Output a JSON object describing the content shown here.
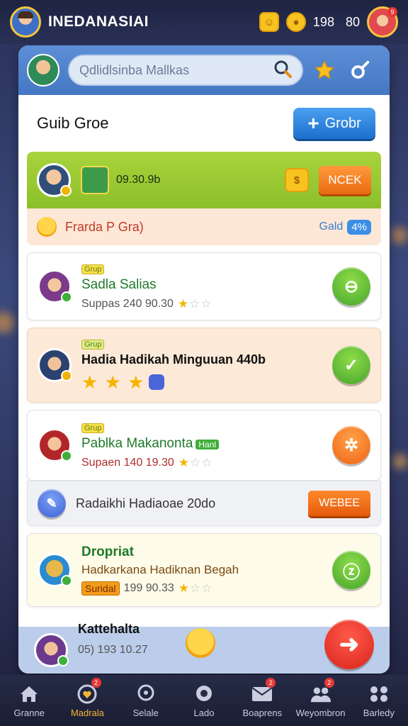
{
  "topbar": {
    "title": "INEDANASIAI",
    "counter_a": "198",
    "counter_b": "80",
    "badge_count": "9"
  },
  "header": {
    "search_placeholder": "Qdlidlsinba Mallkas"
  },
  "section": {
    "title": "Guib Groe",
    "add_button": "Grobr"
  },
  "featured": {
    "value": "09.30.9b",
    "button": "NCEK",
    "status_text": "Frarda P Gra)",
    "status_right_label": "Gald",
    "status_right_pill": "4%"
  },
  "items": [
    {
      "tag": "Grup",
      "name": "Sadla Salias",
      "sub": "Suppas  240 90.30"
    },
    {
      "tag": "Grup",
      "name": "Hadia Hadikah Minguuan 440b"
    },
    {
      "tag": "Grup",
      "name": "Pablka Makanonta",
      "name_tag": "Hanl",
      "sub": "Supaen  140 19.30"
    },
    {
      "name": "Radaikhi Hadiaoae 20do",
      "button": "WEBEE"
    },
    {
      "name": "Dropriat",
      "line2": "Hadkarkana Hadiknan Begah",
      "badge": "Suridal",
      "sub": "199 90.33"
    },
    {
      "name": "Kattehalta",
      "sub": "05) 193 10.27"
    }
  ],
  "nav": [
    {
      "label": "Granne"
    },
    {
      "label": "Madrala",
      "badge": "2"
    },
    {
      "label": "Selale"
    },
    {
      "label": "Lado"
    },
    {
      "label": "Boaprens",
      "badge": "2"
    },
    {
      "label": "Weyombron",
      "badge": "2"
    },
    {
      "label": "Barledy"
    }
  ],
  "colors": {
    "accent": "#4578c4",
    "green": "#8cbf2a",
    "orange": "#ea6a10",
    "nav_active": "#f5b436"
  }
}
